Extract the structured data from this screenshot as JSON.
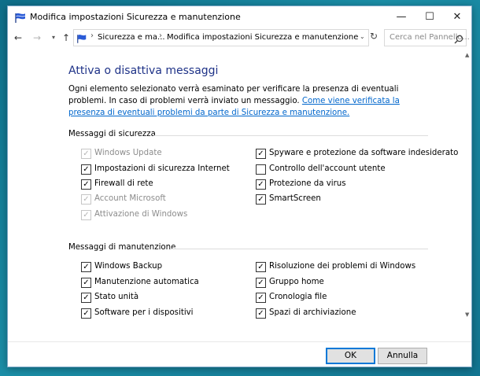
{
  "window": {
    "title": "Modifica impostazioni Sicurezza e manutenzione",
    "minimize_glyph": "—",
    "maximize_glyph": "☐",
    "close_glyph": "✕"
  },
  "nav": {
    "back_glyph": "←",
    "forward_glyph": "→",
    "recent_glyph": "▾",
    "up_glyph": "↑",
    "breadcrumb": [
      "Sicurezza e ma...",
      "Modifica impostazioni Sicurezza e manutenzione"
    ],
    "separator_glyph": "›",
    "dropdown_glyph": "⌄",
    "refresh_glyph": "↻"
  },
  "search": {
    "placeholder": "Cerca nel Pannello..."
  },
  "main": {
    "heading": "Attiva o disattiva messaggi",
    "description": "Ogni elemento selezionato verrà esaminato per verificare la presenza di eventuali problemi. In caso di problemi verrà inviato un messaggio.",
    "link": "Come viene verificata la presenza di eventuali problemi da parte di Sicurezza e manutenzione."
  },
  "security": {
    "title": "Messaggi di sicurezza",
    "items": [
      {
        "label": "Windows Update",
        "checked": true,
        "disabled": true
      },
      {
        "label": "Impostazioni di sicurezza Internet",
        "checked": true,
        "disabled": false
      },
      {
        "label": "Firewall di rete",
        "checked": true,
        "disabled": false
      },
      {
        "label": "Account Microsoft",
        "checked": true,
        "disabled": true
      },
      {
        "label": "Attivazione di Windows",
        "checked": true,
        "disabled": true
      },
      {
        "label": "Spyware e protezione da software indesiderato",
        "checked": true,
        "disabled": false
      },
      {
        "label": "Controllo dell'account utente",
        "checked": false,
        "disabled": false
      },
      {
        "label": "Protezione da virus",
        "checked": true,
        "disabled": false
      },
      {
        "label": "SmartScreen",
        "checked": true,
        "disabled": false
      }
    ]
  },
  "maintenance": {
    "title": "Messaggi di manutenzione",
    "items": [
      {
        "label": "Windows Backup",
        "checked": true,
        "disabled": false
      },
      {
        "label": "Manutenzione automatica",
        "checked": true,
        "disabled": false
      },
      {
        "label": "Stato unità",
        "checked": true,
        "disabled": false
      },
      {
        "label": "Software per i dispositivi",
        "checked": true,
        "disabled": false
      },
      {
        "label": "Risoluzione dei problemi di Windows",
        "checked": true,
        "disabled": false
      },
      {
        "label": "Gruppo home",
        "checked": true,
        "disabled": false
      },
      {
        "label": "Cronologia file",
        "checked": true,
        "disabled": false
      },
      {
        "label": "Spazi di archiviazione",
        "checked": true,
        "disabled": false
      }
    ]
  },
  "check_glyph": "✓",
  "scroll": {
    "up_glyph": "▲",
    "down_glyph": "▼"
  },
  "buttons": {
    "ok": "OK",
    "cancel": "Annulla"
  }
}
